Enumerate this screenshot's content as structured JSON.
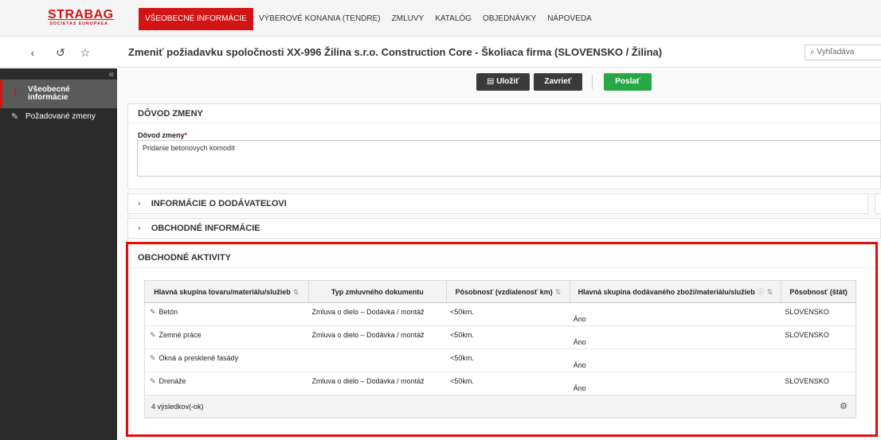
{
  "logo": {
    "brand": "STRABAG",
    "sub": "SOCIETAS EUROPAEA"
  },
  "nav": {
    "items": [
      "VŠEOBECNÉ INFORMÁCIE",
      "VÝBEROVÉ KONANIA (TENDRE)",
      "ZMLUVY",
      "KATALÓG",
      "OBJEDNÁVKY",
      "NÁPOVEDA"
    ]
  },
  "titlebar": {
    "title": "Zmeniť požiadavku spoločnosti XX-996 Žilina s.r.o. Construction Core - Školiaca firma (SLOVENSKO / Žilina)",
    "search_placeholder": "Vyhľadáva"
  },
  "sidebar": {
    "active_label_1": "Všeobecné",
    "active_label_2": "informácie",
    "item_2": "Požadované zmeny"
  },
  "toolbar": {
    "save": "Uložiť",
    "close": "Zavrieť",
    "send": "Poslať"
  },
  "reason_panel": {
    "title": "DÔVOD ZMENY",
    "label": "Dôvod zmeny",
    "required": "*",
    "value": "Pridanie betonovych komodit"
  },
  "supplier_panel": {
    "title": "INFORMÁCIE O DODÁVATEĽOVI"
  },
  "business_panel": {
    "title": "OBCHODNÉ INFORMÁCIE"
  },
  "activities_panel": {
    "title": "OBCHODNÉ AKTIVITY",
    "columns": [
      "Hlavná skupina tovaru/materiálu/služieb",
      "Typ zmluvného dokumentu",
      "Pôsobnosť (vzdialenosť km)",
      "Hlavná skupina dodávaného zboží/materiálu/služieb",
      "Pôsobnosť (štát)"
    ],
    "rows": [
      [
        "Betón",
        "Zmluva o dielo – Dodávka / montáž",
        "<50km.",
        "Áno",
        "SLOVENSKO"
      ],
      [
        "Zemné práce",
        "Zmluva o dielo – Dodávka / montáž",
        "<50km.",
        "Áno",
        "SLOVENSKO"
      ],
      [
        "Okná a presklené fasády",
        "",
        "<50km.",
        "Áno",
        ""
      ],
      [
        "Drenáže",
        "Zmluva o dielo – Dodávka / montáž",
        "<50km.",
        "Áno",
        "SLOVENSKO"
      ]
    ],
    "footer": "4 výsledkov(-ok)"
  }
}
